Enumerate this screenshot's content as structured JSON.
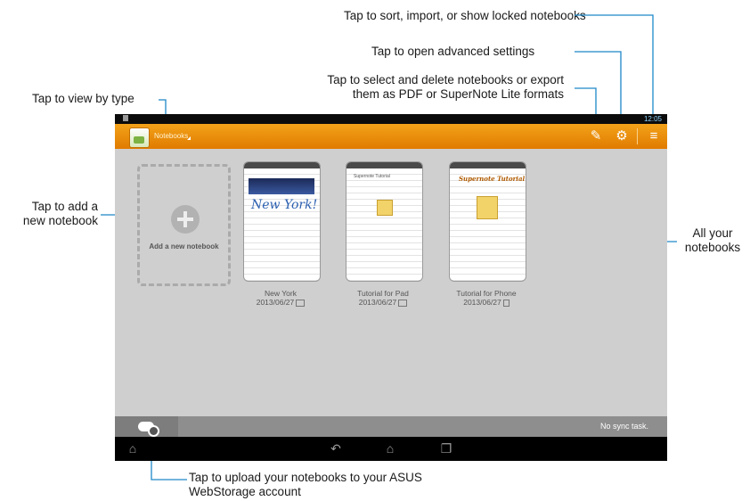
{
  "callouts": {
    "sort": "Tap to sort, import, or show locked notebooks",
    "advanced": "Tap to open advanced settings",
    "select_line1": "Tap to select and delete notebooks or export",
    "select_line2": "them as PDF or SuperNote Lite formats",
    "view_by_type": "Tap to view by type",
    "add_line1": "Tap to add a",
    "add_line2": "new notebook",
    "all_line1": "All your",
    "all_line2": "notebooks",
    "upload_line1": "Tap to upload your notebooks to your ASUS",
    "upload_line2": "WebStorage account"
  },
  "statusbar": {
    "time": "12:05"
  },
  "actionbar": {
    "title": "Notebooks"
  },
  "add_tile": {
    "label": "Add a new notebook"
  },
  "notebooks": [
    {
      "name": "New York",
      "date": "2013/06/27",
      "thumb_text": "New York!"
    },
    {
      "name": "Tutorial for Pad",
      "date": "2013/06/27",
      "thumb_text": "Supernote Tutorial"
    },
    {
      "name": "Tutorial for Phone",
      "date": "2013/06/27",
      "thumb_text": "Supernote Tutorial"
    }
  ],
  "bottombar": {
    "sync_status": "No sync task."
  },
  "colors": {
    "actionbar": "#e88a00",
    "callout_line": "#1e88c8",
    "background": "#cfcfcf"
  },
  "icons": {
    "actionbar": [
      "select-edit-icon",
      "settings-gear-icon",
      "menu-sort-icon"
    ],
    "bottom": "cloud-upload-icon",
    "nav": [
      "home-icon",
      "back-icon",
      "home-icon",
      "recent-apps-icon"
    ]
  }
}
